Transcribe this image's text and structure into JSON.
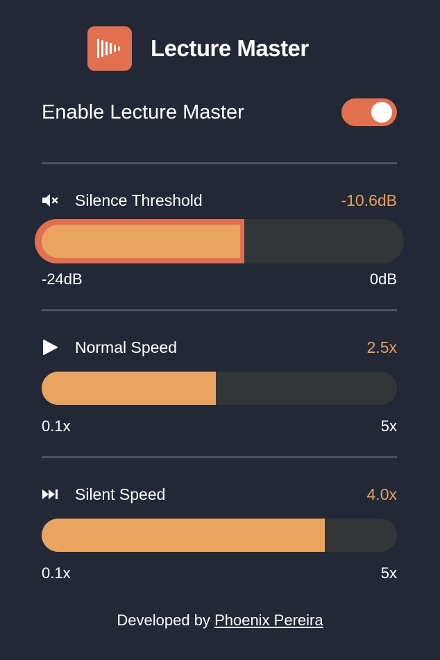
{
  "app": {
    "title": "Lecture Master",
    "logo_icon": "waveform-icon",
    "accent_color": "#e0704f",
    "value_color": "#e5a25f"
  },
  "enable": {
    "label": "Enable Lecture Master",
    "enabled": true
  },
  "settings": [
    {
      "icon": "mute-icon",
      "label": "Silence Threshold",
      "value": "-10.6dB",
      "min_label": "-24dB",
      "max_label": "0dB",
      "min": -24,
      "max": 0,
      "current": -10.6,
      "focused": true
    },
    {
      "icon": "play-icon",
      "label": "Normal Speed",
      "value": "2.5x",
      "min_label": "0.1x",
      "max_label": "5x",
      "min": 0.1,
      "max": 5,
      "current": 2.5,
      "focused": false
    },
    {
      "icon": "fast-forward-icon",
      "label": "Silent Speed",
      "value": "4.0x",
      "min_label": "0.1x",
      "max_label": "5x",
      "min": 0.1,
      "max": 5,
      "current": 4.0,
      "focused": false
    }
  ],
  "footer": {
    "prefix": "Developed by",
    "author": "Phoenix Pereira"
  }
}
